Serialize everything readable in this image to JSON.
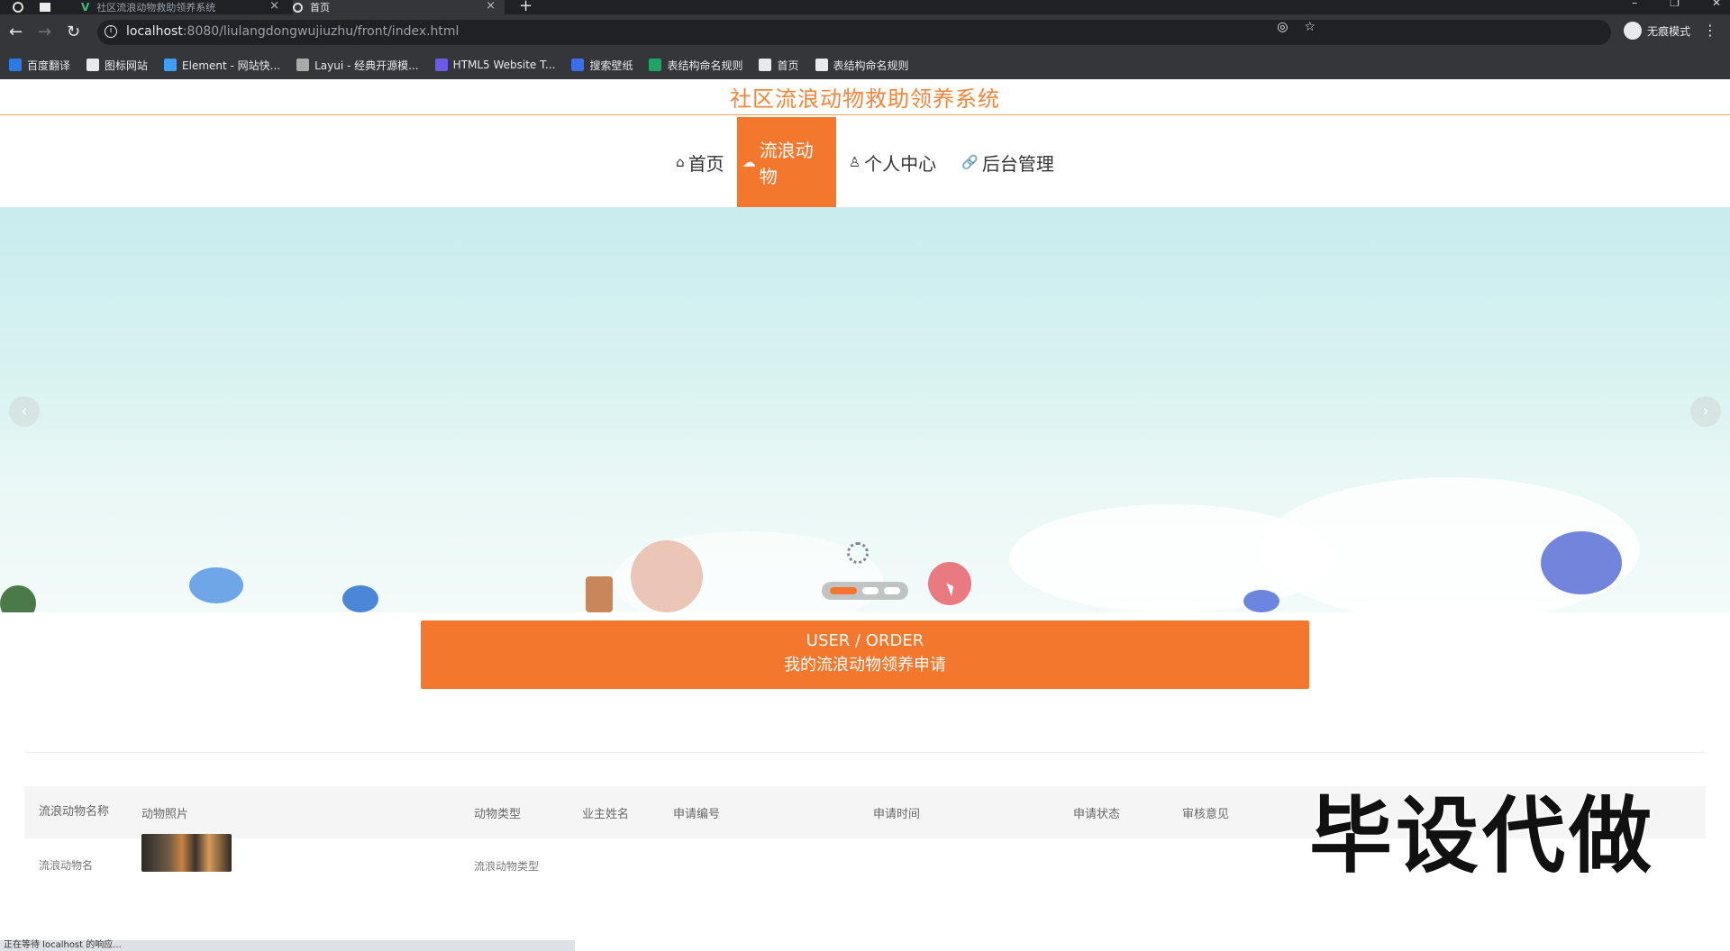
{
  "browser": {
    "tabs": [
      {
        "title": "社区流浪动物救助领养系统"
      },
      {
        "title": "首页"
      }
    ],
    "new_tab": "+",
    "url_host": "localhost",
    "url_rest": ":8080/liulangdongwujiuzhu/front/index.html",
    "incognito_label": "无痕模式",
    "bookmarks": [
      {
        "label": "百度翻译",
        "color": "#2c7be5"
      },
      {
        "label": "图标网站",
        "color": "#e8eaed"
      },
      {
        "label": "Element - 网站快...",
        "color": "#409eff"
      },
      {
        "label": "Layui - 经典开源模...",
        "color": "#aaaaaa"
      },
      {
        "label": "HTML5 Website T...",
        "color": "#6b5be8"
      },
      {
        "label": "搜索壁纸",
        "color": "#3b6ee8"
      },
      {
        "label": "表结构命名规则",
        "color": "#1fa463"
      },
      {
        "label": "首页",
        "color": "#e8eaed"
      },
      {
        "label": "表结构命名规则",
        "color": "#e8eaed"
      }
    ]
  },
  "site": {
    "title": "社区流浪动物救助领养系统",
    "nav": [
      {
        "icon": "⌂",
        "label": "首页",
        "active": false
      },
      {
        "icon": "☁",
        "label": "流浪动物",
        "active": true
      },
      {
        "icon": "♙",
        "label": "个人中心",
        "active": false
      },
      {
        "icon": "🔗",
        "label": "后台管理",
        "active": false
      }
    ],
    "carousel": {
      "arrow_prev": "‹",
      "arrow_next": "›",
      "slide_count": 3,
      "active_slide": 1
    }
  },
  "order": {
    "title_en": "USER / ORDER",
    "title_cn": "我的流浪动物领养申请"
  },
  "table": {
    "headers": [
      "流浪动物名称",
      "动物照片",
      "动物类型",
      "业主姓名",
      "申请编号",
      "申请时间",
      "申请状态",
      "审核意见"
    ],
    "rows": [
      {
        "name": "流浪动物名",
        "type": "流浪动物类型",
        "owner": "",
        "code": "",
        "time": "",
        "status": "",
        "opinion": ""
      }
    ]
  },
  "watermark": "毕设代做",
  "status_text": "正在等待 localhost 的响应..."
}
